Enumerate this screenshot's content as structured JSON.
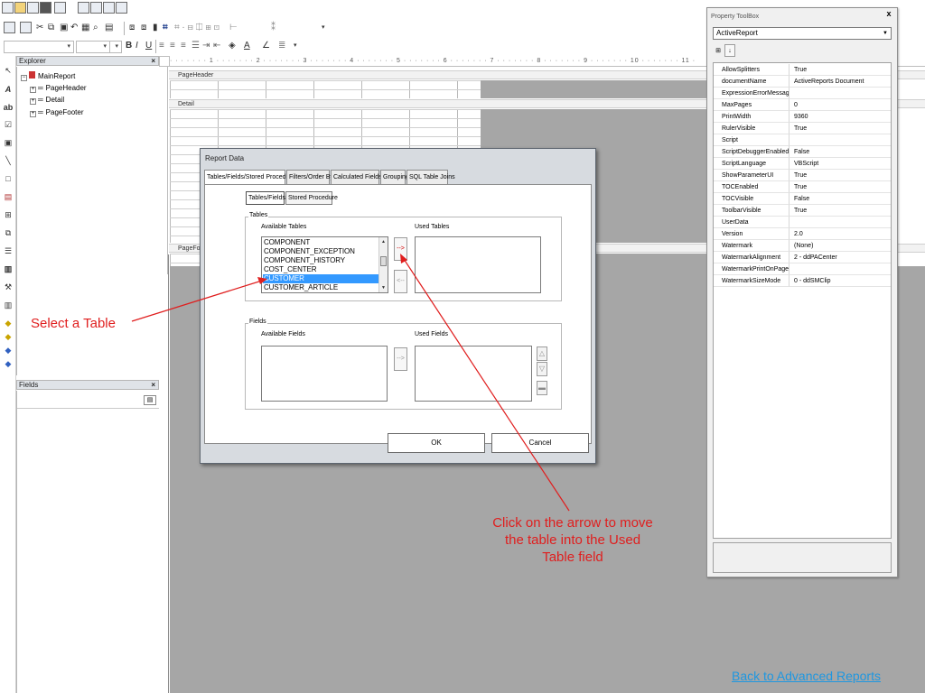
{
  "toolbar": {
    "combo_arrow": "▾",
    "bold": "B",
    "italic": "I",
    "underline": "U"
  },
  "explorer": {
    "title": "Explorer",
    "close": "×",
    "items": [
      {
        "label": "MainReport"
      },
      {
        "label": "PageHeader"
      },
      {
        "label": "Detail"
      },
      {
        "label": "PageFooter"
      }
    ]
  },
  "fields_panel": {
    "title": "Fields",
    "close": "×"
  },
  "designer": {
    "ruler_text": "· · · · · · · 1 · · · · · · · 2 · · · · · · · 3 · · · · · · · 4 · · · · · · · 5 · · · · · · · 6 · · · · · · · 7 · · · · · · · 8 · · · · · · · 9 · · · · · · · 10 · · · · · · · 11 ·",
    "sections": {
      "page_header": "PageHeader",
      "detail": "Detail",
      "page_footer": "PageFoot"
    }
  },
  "property_toolbox": {
    "title": "Property ToolBox",
    "close": "x",
    "selected_object": "ActiveReport",
    "properties": [
      {
        "name": "AllowSplitters",
        "value": "True"
      },
      {
        "name": "documentName",
        "value": "ActiveReports Document"
      },
      {
        "name": "ExpressionErrorMessage",
        "value": ""
      },
      {
        "name": "MaxPages",
        "value": "0"
      },
      {
        "name": "PrintWidth",
        "value": "9360"
      },
      {
        "name": "RulerVisible",
        "value": "True"
      },
      {
        "name": "Script",
        "value": ""
      },
      {
        "name": "ScriptDebuggerEnabled",
        "value": "False"
      },
      {
        "name": "ScriptLanguage",
        "value": "VBScript"
      },
      {
        "name": "ShowParameterUI",
        "value": "True"
      },
      {
        "name": "TOCEnabled",
        "value": "True"
      },
      {
        "name": "TOCVisible",
        "value": "False"
      },
      {
        "name": "ToolbarVisible",
        "value": "True"
      },
      {
        "name": "UserData",
        "value": ""
      },
      {
        "name": "Version",
        "value": "2.0"
      },
      {
        "name": "Watermark",
        "value": "(None)"
      },
      {
        "name": "WatermarkAlignment",
        "value": "2 - ddPACenter"
      },
      {
        "name": "WatermarkPrintOnPages",
        "value": ""
      },
      {
        "name": "WatermarkSizeMode",
        "value": "0 - ddSMClip"
      }
    ]
  },
  "dialog": {
    "title": "Report Data",
    "tabs": [
      {
        "label": "Tables/Fields/Stored Procedure",
        "active": true
      },
      {
        "label": "Filters/Order By",
        "active": false
      },
      {
        "label": "Calculated Fields",
        "active": false
      },
      {
        "label": "Grouping",
        "active": false
      },
      {
        "label": "SQL Table Joins",
        "active": false
      }
    ],
    "subtabs": [
      {
        "label": "Tables/Fields"
      },
      {
        "label": "Stored Procedure"
      }
    ],
    "tables_group": {
      "label": "Tables",
      "available_label": "Available Tables",
      "used_label": "Used Tables",
      "available": [
        "COMPONENT",
        "COMPONENT_EXCEPTION",
        "COMPONENT_HISTORY",
        "COST_CENTER",
        "CUSTOMER",
        "CUSTOMER_ARTICLE"
      ],
      "selected": "CUSTOMER",
      "used": []
    },
    "fields_group": {
      "label": "Fields",
      "available_label": "Available Fields",
      "used_label": "Used Fields"
    },
    "move_right": "-->",
    "move_left": "<--",
    "ok": "OK",
    "cancel": "Cancel"
  },
  "annotations": {
    "select_table": "Select a Table",
    "arrow_note_line1": "Click on the arrow to move",
    "arrow_note_line2": "the table into the Used",
    "arrow_note_line3": "Table field",
    "color": "#e01e1e"
  },
  "back_link": "Back to Advanced Reports"
}
